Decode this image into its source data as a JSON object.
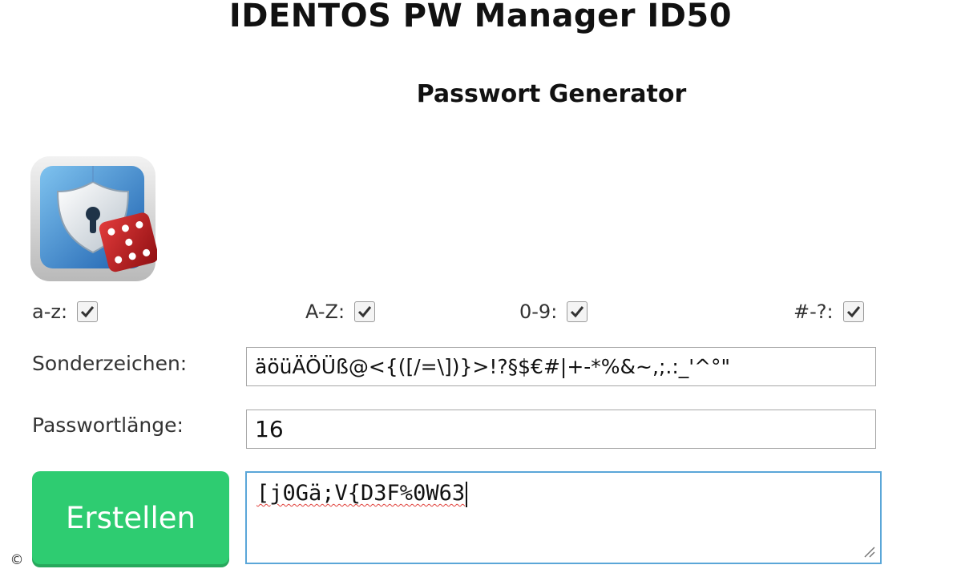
{
  "app": {
    "title": "IDENTOS PW Manager ID50",
    "subtitle": "Passwort Generator"
  },
  "logo": {
    "icon": "shield-lock-dice-icon"
  },
  "options": [
    {
      "label": "a-z:",
      "checked": true
    },
    {
      "label": "A-Z:",
      "checked": true
    },
    {
      "label": "0-9:",
      "checked": true
    },
    {
      "label": "#-?:",
      "checked": true
    }
  ],
  "special": {
    "label": "Sonderzeichen:",
    "value": "äöüÄÖÜß@<{([/=\\])}>!?§$€#|+-*%&~,;.:_'^°\""
  },
  "length": {
    "label": "Passwortlänge:",
    "value": "16"
  },
  "generate": {
    "label": "Erstellen",
    "color": "#2ecc71"
  },
  "output": {
    "value": "[j0Gä;V{D3F%0W63"
  },
  "copyright_symbol": "©"
}
